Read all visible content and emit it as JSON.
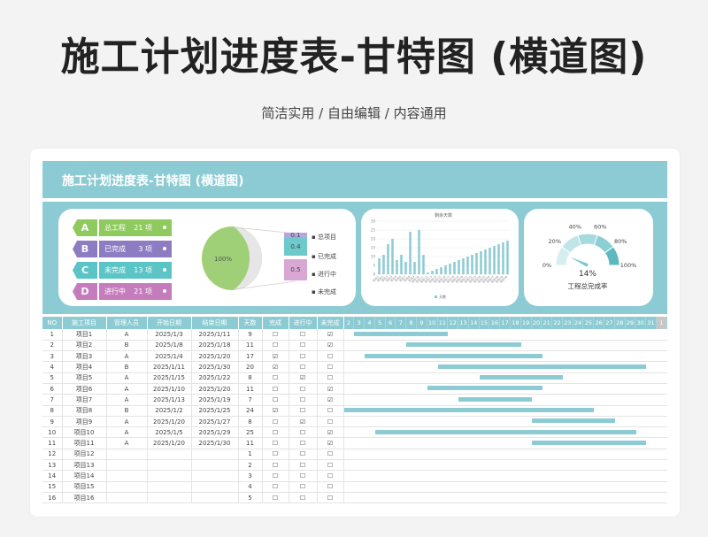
{
  "header": {
    "title": "施工计划进度表-甘特图 (横道图)",
    "subtitle": "简洁实用 / 自由编辑 / 内容通用"
  },
  "sheet": {
    "title": "施工计划进度表-甘特图 (横道图)"
  },
  "colors": {
    "accent": "#8ccbd3",
    "bar": "#8ccbd3",
    "total": "#8fca5f",
    "completed": "#8e7cc3",
    "not_completed": "#5bc4c7",
    "in_progress": "#c57cbc"
  },
  "legend": [
    {
      "letter": "A",
      "label": "总工程",
      "count": "21 项",
      "color": "#8fca5f"
    },
    {
      "letter": "B",
      "label": "已完成",
      "count": "3 项",
      "color": "#8e7cc3"
    },
    {
      "letter": "C",
      "label": "未完成",
      "count": "13 项",
      "color": "#5bc4c7"
    },
    {
      "letter": "D",
      "label": "进行中",
      "count": "21 项",
      "color": "#c57cbc"
    }
  ],
  "pie": {
    "value_label": "100%"
  },
  "stack": {
    "segments": [
      {
        "value": "0.1",
        "color": "#b5a6dc"
      },
      {
        "value": "0.4",
        "color": "#6ec9cb"
      },
      {
        "value": "0.5",
        "color": "#d8a8d2"
      }
    ],
    "labels": [
      "总项目",
      "已完成",
      "进行中",
      "未完成"
    ]
  },
  "chart_data": [
    {
      "type": "bar",
      "title": "剩余天数",
      "categories": [
        "项目1",
        "项目2",
        "项目3",
        "项目4",
        "项目5",
        "项目6",
        "项目7",
        "项目8",
        "项目9",
        "项目10",
        "项目11",
        "项目12",
        "项目13",
        "项目14",
        "项目15",
        "项目16",
        "项目17",
        "项目18",
        "项目19",
        "项目20",
        "项目21",
        "项目22",
        "项目23",
        "项目24",
        "项目25",
        "项目26",
        "项目27",
        "项目28",
        "项目29",
        "项目30"
      ],
      "series": [
        {
          "name": "天数",
          "values": [
            9,
            11,
            17,
            20,
            8,
            11,
            7,
            24,
            7,
            25,
            11,
            1,
            2,
            3,
            4,
            5,
            6,
            7,
            8,
            9,
            10,
            11,
            12,
            13,
            14,
            15,
            16,
            17,
            18,
            19
          ]
        }
      ],
      "ylim": [
        0,
        30
      ]
    },
    {
      "type": "gauge",
      "value": 14,
      "value_label": "14%",
      "tick_labels": [
        "0%",
        "20%",
        "40%",
        "60%",
        "80%",
        "100%"
      ],
      "label": "工程总完成率"
    }
  ],
  "table": {
    "columns": [
      "NO",
      "施工项目",
      "管理人员",
      "开始日期",
      "结束日期",
      "天数",
      "完成",
      "进行中",
      "未完成"
    ],
    "days": [
      "2",
      "3",
      "4",
      "5",
      "6",
      "7",
      "8",
      "9",
      "10",
      "11",
      "12",
      "13",
      "14",
      "15",
      "16",
      "17",
      "18",
      "19",
      "20",
      "21",
      "22",
      "23",
      "24",
      "25",
      "26",
      "27",
      "28",
      "29",
      "30",
      "31",
      "1"
    ],
    "rows": [
      {
        "no": "1",
        "name": "项目1",
        "mgr": "A",
        "start": "2025/1/3",
        "end": "2025/1/11",
        "days": "9",
        "done": "☐",
        "prog": "☐",
        "undone": "☑",
        "s": 3,
        "e": 11
      },
      {
        "no": "2",
        "name": "项目2",
        "mgr": "B",
        "start": "2025/1/8",
        "end": "2025/1/18",
        "days": "11",
        "done": "☐",
        "prog": "☐",
        "undone": "☑",
        "s": 8,
        "e": 18
      },
      {
        "no": "3",
        "name": "项目3",
        "mgr": "A",
        "start": "2025/1/4",
        "end": "2025/1/20",
        "days": "17",
        "done": "☑",
        "prog": "☐",
        "undone": "☐",
        "s": 4,
        "e": 20
      },
      {
        "no": "4",
        "name": "项目4",
        "mgr": "B",
        "start": "2025/1/11",
        "end": "2025/1/30",
        "days": "20",
        "done": "☑",
        "prog": "☐",
        "undone": "☐",
        "s": 11,
        "e": 30
      },
      {
        "no": "5",
        "name": "项目5",
        "mgr": "A",
        "start": "2025/1/15",
        "end": "2025/1/22",
        "days": "8",
        "done": "☐",
        "prog": "☑",
        "undone": "☐",
        "s": 15,
        "e": 22
      },
      {
        "no": "6",
        "name": "项目6",
        "mgr": "A",
        "start": "2025/1/10",
        "end": "2025/1/20",
        "days": "11",
        "done": "☐",
        "prog": "☐",
        "undone": "☑",
        "s": 10,
        "e": 20
      },
      {
        "no": "7",
        "name": "项目7",
        "mgr": "A",
        "start": "2025/1/13",
        "end": "2025/1/19",
        "days": "7",
        "done": "☐",
        "prog": "☐",
        "undone": "☑",
        "s": 13,
        "e": 19
      },
      {
        "no": "8",
        "name": "项目8",
        "mgr": "B",
        "start": "2025/1/2",
        "end": "2025/1/25",
        "days": "24",
        "done": "☑",
        "prog": "☐",
        "undone": "☐",
        "s": 2,
        "e": 25
      },
      {
        "no": "9",
        "name": "项目9",
        "mgr": "A",
        "start": "2025/1/20",
        "end": "2025/1/27",
        "days": "8",
        "done": "☐",
        "prog": "☑",
        "undone": "☐",
        "s": 20,
        "e": 27
      },
      {
        "no": "10",
        "name": "项目10",
        "mgr": "A",
        "start": "2025/1/5",
        "end": "2025/1/29",
        "days": "25",
        "done": "☐",
        "prog": "☐",
        "undone": "☑",
        "s": 5,
        "e": 29
      },
      {
        "no": "11",
        "name": "项目11",
        "mgr": "A",
        "start": "2025/1/20",
        "end": "2025/1/30",
        "days": "11",
        "done": "☐",
        "prog": "☐",
        "undone": "☑",
        "s": 20,
        "e": 30
      },
      {
        "no": "12",
        "name": "项目12",
        "mgr": "",
        "start": "",
        "end": "",
        "days": "1",
        "done": "☐",
        "prog": "☐",
        "undone": "☐"
      },
      {
        "no": "13",
        "name": "项目13",
        "mgr": "",
        "start": "",
        "end": "",
        "days": "2",
        "done": "☐",
        "prog": "☐",
        "undone": "☐"
      },
      {
        "no": "14",
        "name": "项目14",
        "mgr": "",
        "start": "",
        "end": "",
        "days": "3",
        "done": "☐",
        "prog": "☐",
        "undone": "☐"
      },
      {
        "no": "15",
        "name": "项目15",
        "mgr": "",
        "start": "",
        "end": "",
        "days": "4",
        "done": "☐",
        "prog": "☐",
        "undone": "☐"
      },
      {
        "no": "16",
        "name": "项目16",
        "mgr": "",
        "start": "",
        "end": "",
        "days": "5",
        "done": "☐",
        "prog": "☐",
        "undone": "☐"
      }
    ]
  }
}
